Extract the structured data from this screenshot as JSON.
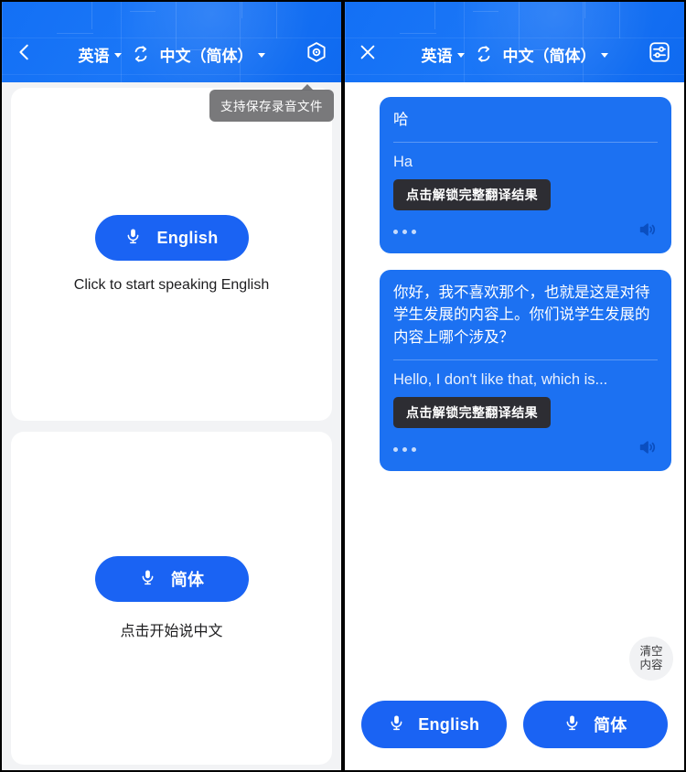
{
  "app": {
    "accent_blue": "#1370F5",
    "bubble_blue": "#1C71F2",
    "button_blue": "#1A63F3",
    "page_bg": "#F2F3F5",
    "unlock_bg": "#2D2D33"
  },
  "left": {
    "header": {
      "back_icon": "chevron-left-icon",
      "source_lang": "英语",
      "swap_icon": "swap-languages-icon",
      "target_lang": "中文（简体）",
      "settings_icon": "hexagon-settings-icon"
    },
    "tooltip": "支持保存录音文件",
    "cards": [
      {
        "mic_icon": "microphone-icon",
        "button_label": "English",
        "hint": "Click to start speaking English"
      },
      {
        "mic_icon": "microphone-icon",
        "button_label": "简体",
        "hint": "点击开始说中文"
      }
    ]
  },
  "right": {
    "header": {
      "close_icon": "close-icon",
      "source_lang": "英语",
      "swap_icon": "swap-languages-icon",
      "target_lang": "中文（简体）",
      "settings_icon": "sliders-settings-icon"
    },
    "messages": [
      {
        "source_text": "哈",
        "translated_text": "Ha",
        "unlock_label": "点击解锁完整翻译结果",
        "more_icon": "more-dots-icon",
        "speaker_icon": "speaker-icon"
      },
      {
        "source_text": "你好，我不喜欢那个，也就是这是对待学生发展的内容上。你们说学生发展的内容上哪个涉及？",
        "translated_text": "Hello, I don't like that, which is...",
        "unlock_label": "点击解锁完整翻译结果",
        "more_icon": "more-dots-icon",
        "speaker_icon": "speaker-icon"
      }
    ],
    "clear_button": {
      "line1": "清空",
      "line2": "内容"
    },
    "bottom_buttons": [
      {
        "mic_icon": "microphone-icon",
        "label": "English"
      },
      {
        "mic_icon": "microphone-icon",
        "label": "简体"
      }
    ]
  }
}
